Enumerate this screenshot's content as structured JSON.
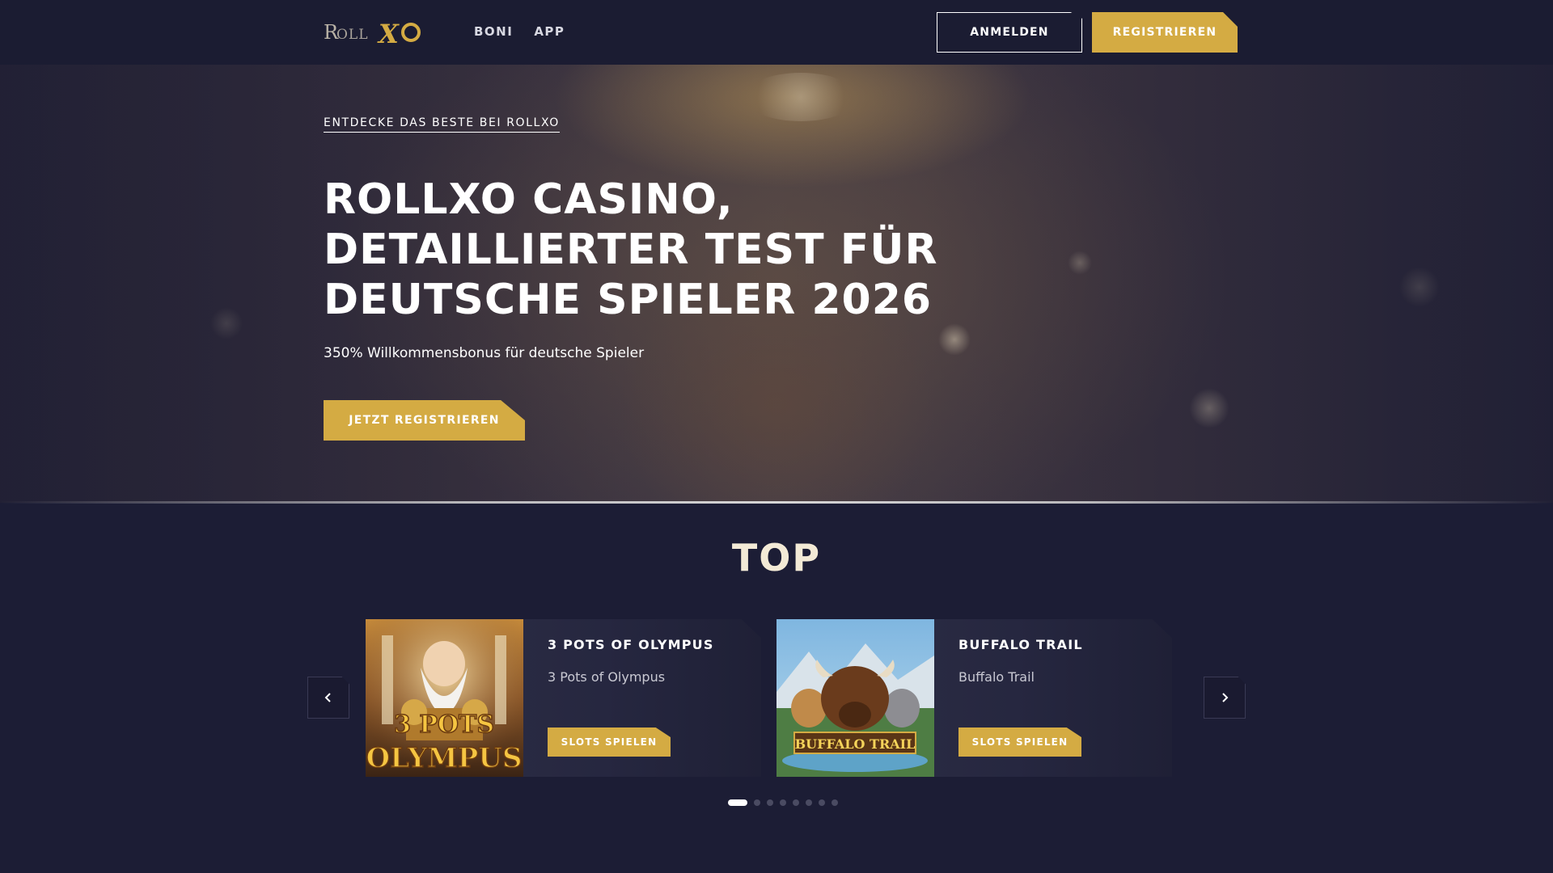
{
  "header": {
    "logo_alt": "RollXO",
    "nav": [
      {
        "label": "BONI"
      },
      {
        "label": "APP"
      }
    ],
    "login_label": "ANMELDEN",
    "register_label": "REGISTRIEREN"
  },
  "hero": {
    "kicker": "ENTDECKE DAS BESTE BEI ROLLXO",
    "title_lines": [
      "ROLLXO CASINO,",
      "DETAILLIERTER TEST FÜR",
      "DEUTSCHE SPIELER 2026"
    ],
    "subtitle": "350% Willkommensbonus für deutsche Spieler",
    "cta_label": "JETZT REGISTRIEREN"
  },
  "top": {
    "title": "TOP",
    "cards": [
      {
        "title": "3 POTS OF OLYMPUS",
        "subtitle": "3 Pots of Olympus",
        "button": "SLOTS SPIELEN",
        "thumb_text_top": "3 POTS",
        "thumb_text_bottom": "OLYMPUS"
      },
      {
        "title": "BUFFALO TRAIL",
        "subtitle": "Buffalo Trail",
        "button": "SLOTS SPIELEN",
        "thumb_text": "BUFFALO TRAIL"
      }
    ],
    "dots_total": 8,
    "dots_active": 0
  },
  "colors": {
    "gold": "#d4ab43",
    "bg": "#1c1d35",
    "header": "#1b1c32"
  },
  "icons": {
    "prev": "chevron-left-icon",
    "next": "chevron-right-icon"
  }
}
